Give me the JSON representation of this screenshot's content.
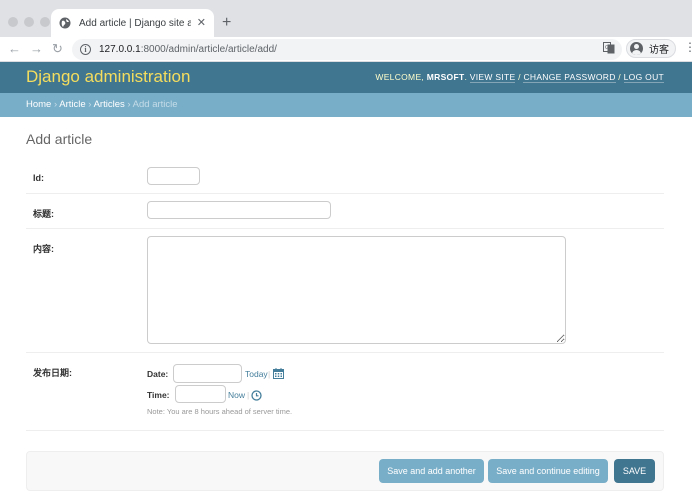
{
  "browser": {
    "tab_title": "Add article | Django site admin",
    "url_host": "127.0.0.1",
    "url_rest": ":8000/admin/article/article/add/",
    "profile_label": "访客"
  },
  "header": {
    "site_name": "Django administration",
    "welcome": "WELCOME,",
    "username": "MRSOFT",
    "view_site": "VIEW SITE",
    "change_password": "CHANGE PASSWORD",
    "log_out": "LOG OUT"
  },
  "breadcrumbs": {
    "home": "Home",
    "app": "Article",
    "model": "Articles",
    "current": "Add article"
  },
  "page": {
    "title": "Add article"
  },
  "form": {
    "id_label": "Id:",
    "id_value": "",
    "title_label": "标题:",
    "title_value": "",
    "content_label": "内容:",
    "content_value": "",
    "date_label": "发布日期:",
    "date_sub": "Date:",
    "date_value": "",
    "today": "Today",
    "time_sub": "Time:",
    "time_value": "",
    "now": "Now",
    "separator": "|",
    "tz_note": "Note: You are 8 hours ahead of server time."
  },
  "submit": {
    "save_add_another": "Save and add another",
    "save_continue": "Save and continue editing",
    "save": "SAVE"
  },
  "colors": {
    "header_bg": "#417690",
    "breadcrumb_bg": "#79aec8",
    "branding": "#f5dd5d",
    "link": "#447e9b"
  }
}
